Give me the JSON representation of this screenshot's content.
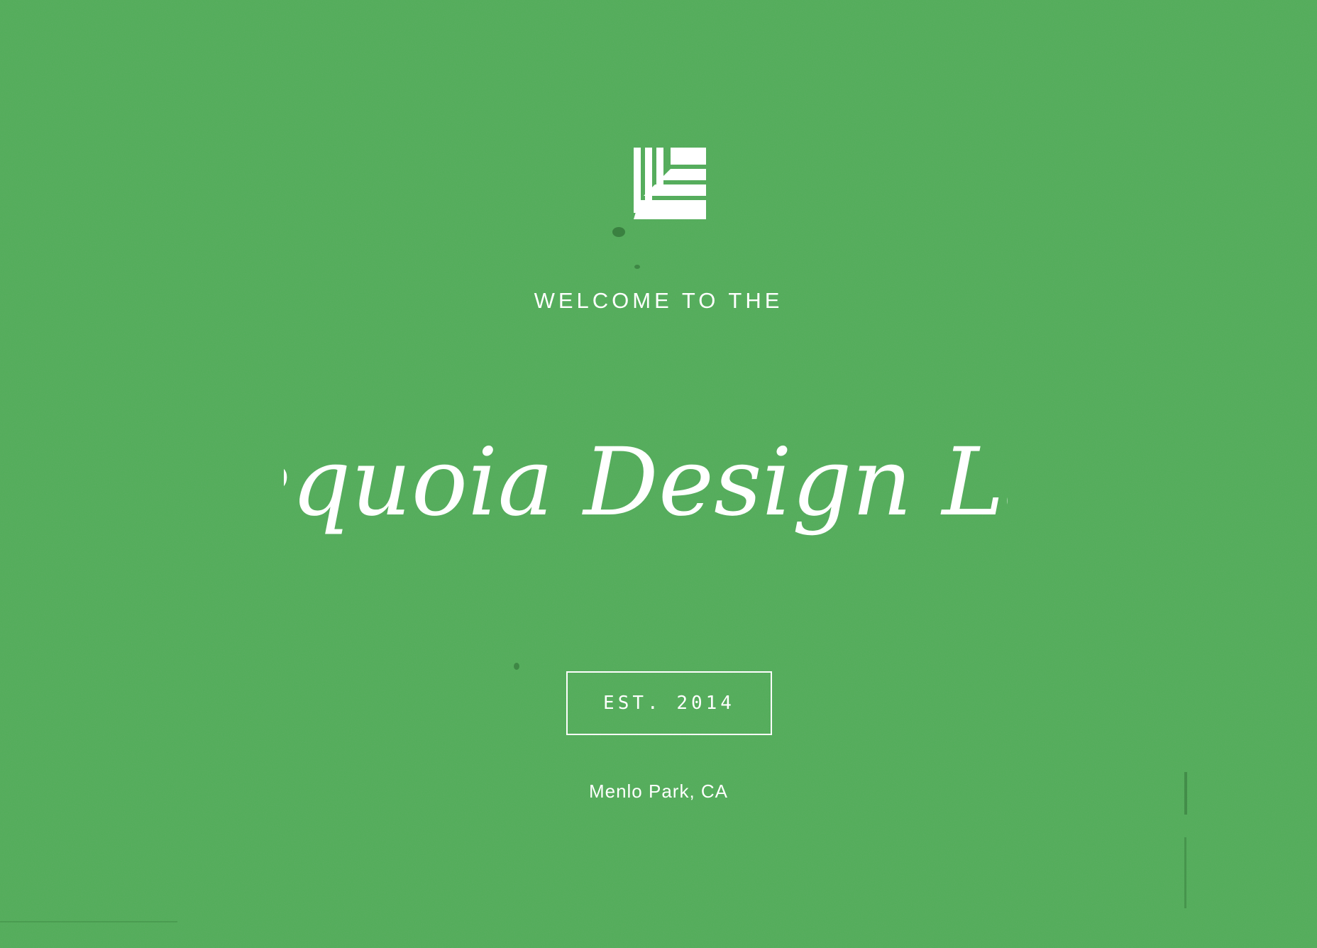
{
  "colors": {
    "background": "#54ad5b",
    "foreground": "#ffffff"
  },
  "hero": {
    "logo_icon": "sequoia-lab-logo",
    "welcome_text": "WELCOME TO THE",
    "title": "Sequoia Design Lab",
    "established": "EST. 2014",
    "location": "Menlo Park, CA"
  }
}
